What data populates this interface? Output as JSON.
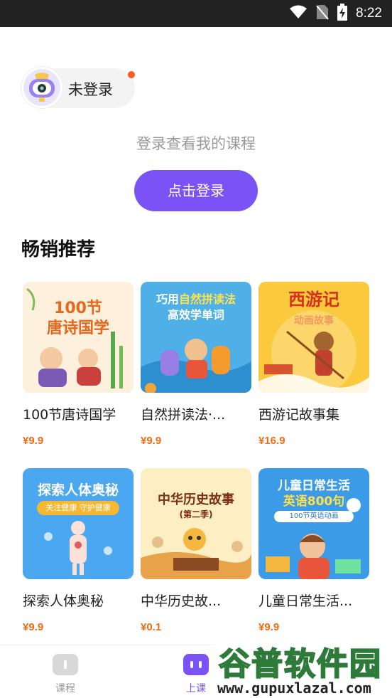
{
  "status_bar": {
    "time": "8:22"
  },
  "user": {
    "name": "未登录"
  },
  "login": {
    "tip": "登录查看我的课程",
    "button_label": "点击登录"
  },
  "section": {
    "title": "畅销推荐"
  },
  "courses": [
    {
      "title": "100节唐诗国学",
      "price": "¥9.9",
      "cover_text": "100节\n唐诗国学"
    },
    {
      "title": "自然拼读法·...",
      "price": "¥9.9",
      "cover_text": "巧用自然拼读法\n高效学单词"
    },
    {
      "title": "西游记故事集",
      "price": "¥16.9",
      "cover_text": "西游记\n动画故事"
    },
    {
      "title": "探索人体奥秘",
      "price": "¥9.9",
      "cover_text": "探索人体奥秘\n关注健康 守护健康"
    },
    {
      "title": "中华历史故...",
      "price": "¥0.1",
      "cover_text": "中华历史故事\n(第二季)"
    },
    {
      "title": "儿童日常生活...",
      "price": "¥9.9",
      "cover_text": "儿童日常生活\n英语800句\n100节英语动画"
    }
  ],
  "tabs": [
    {
      "label": "课程",
      "active": false
    },
    {
      "label": "上课",
      "active": true
    }
  ],
  "watermark": {
    "line1": "谷普软件园",
    "line2": "www.gupuxlazal.com"
  },
  "colors": {
    "accent": "#7b52f5",
    "price": "#f36a14",
    "status_bar": "#222222"
  }
}
